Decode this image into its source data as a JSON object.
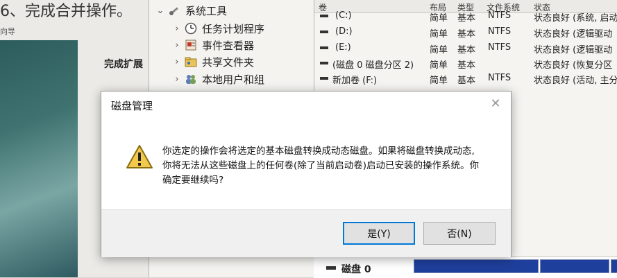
{
  "wizard": {
    "title": "6、完成合并操作。",
    "subtitle": "向导",
    "heading": "完成扩展"
  },
  "tree": {
    "items": [
      {
        "label": "系统工具",
        "icon": "tools-icon",
        "expanded": true
      },
      {
        "label": "任务计划程序",
        "icon": "clock-icon"
      },
      {
        "label": "事件查看器",
        "icon": "event-viewer-icon"
      },
      {
        "label": "共享文件夹",
        "icon": "shared-folder-icon"
      },
      {
        "label": "本地用户和组",
        "icon": "users-icon"
      }
    ]
  },
  "volumes": {
    "columns": [
      "卷",
      "布局",
      "类型",
      "文件系统",
      "状态"
    ],
    "rows": [
      {
        "name": "(C:)",
        "layout": "简单",
        "type": "基本",
        "fs": "NTFS",
        "status": "状态良好 (系统, 启动"
      },
      {
        "name": "(D:)",
        "layout": "简单",
        "type": "基本",
        "fs": "NTFS",
        "status": "状态良好 (逻辑驱动"
      },
      {
        "name": "(E:)",
        "layout": "简单",
        "type": "基本",
        "fs": "NTFS",
        "status": "状态良好 (逻辑驱动"
      },
      {
        "name": "(磁盘 0 磁盘分区 2)",
        "layout": "简单",
        "type": "基本",
        "fs": "",
        "status": "状态良好 (恢复分区"
      },
      {
        "name": "新加卷 (F:)",
        "layout": "简单",
        "type": "基本",
        "fs": "NTFS",
        "status": "状态良好 (活动, 主分"
      }
    ],
    "disk_label": "磁盘 0",
    "partition_color": "#1f3f9c"
  },
  "dialog": {
    "title": "磁盘管理",
    "close_glyph": "✕",
    "message_lines": [
      "你选定的操作会将选定的基本磁盘转换成动态磁盘。如果将磁盘转换成动态,",
      "你将无法从这些磁盘上的任何卷(除了当前启动卷)启动已安装的操作系统。你",
      "确定要继续吗?"
    ],
    "yes_label": "是(Y)",
    "no_label": "否(N)",
    "warning_icon": "warning-icon"
  }
}
